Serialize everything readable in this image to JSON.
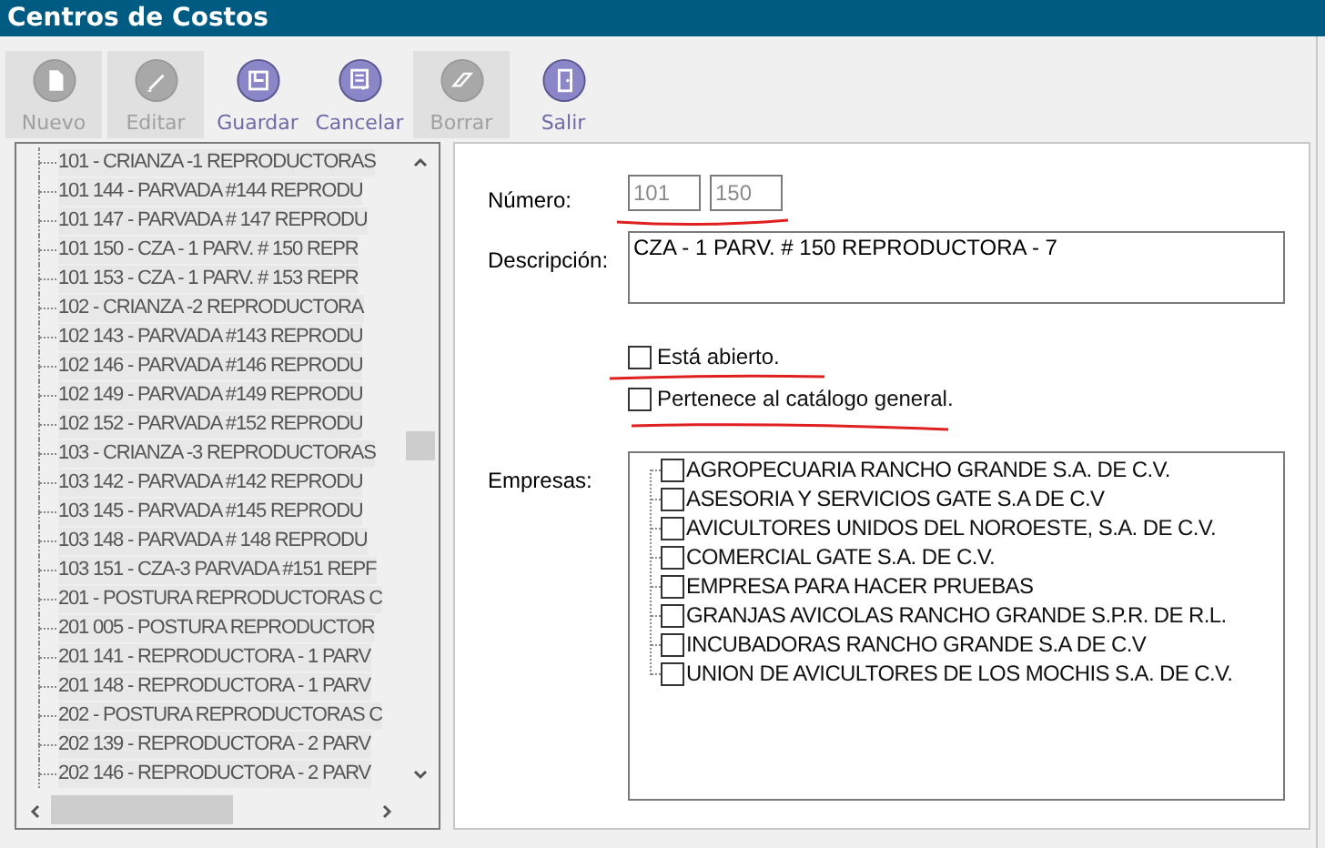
{
  "window": {
    "title": "Centros de Costos"
  },
  "toolbar": [
    {
      "label": "Nuevo",
      "kind": "new",
      "disabled": true
    },
    {
      "label": "Editar",
      "kind": "edit",
      "disabled": true
    },
    {
      "label": "Guardar",
      "kind": "save",
      "disabled": false
    },
    {
      "label": "Cancelar",
      "kind": "cancel",
      "disabled": false
    },
    {
      "label": "Borrar",
      "kind": "delete",
      "disabled": true
    },
    {
      "label": "Salir",
      "kind": "exit",
      "disabled": false
    }
  ],
  "tree": {
    "items": [
      "101 - CRIANZA -1  REPRODUCTORAS",
      "101 144 - PARVADA  #144  REPRODU",
      "101 147 - PARVADA # 147  REPRODU",
      "101 150 - CZA - 1  PARV. # 150  REPR",
      "101 153 - CZA - 1  PARV. # 153  REPR",
      "102 - CRIANZA  -2   REPRODUCTORA",
      "102 143 - PARVADA  #143 REPRODU",
      "102 146 - PARVADA  #146 REPRODU",
      "102 149 - PARVADA #149  REPRODU",
      "102 152 - PARVADA #152  REPRODU",
      "103 - CRIANZA -3  REPRODUCTORAS",
      "103 142 - PARVADA #142  REPRODU",
      "103 145 - PARVADA  #145 REPRODU",
      "103 148 - PARVADA # 148  REPRODU",
      "103 151 - CZA-3 PARVADA #151 REPF",
      "201 - POSTURA REPRODUCTORAS C",
      "201 005 - POSTURA REPRODUCTOR",
      "201 141 - REPRODUCTORA - 1  PARV",
      "201 148 - REPRODUCTORA - 1  PARV",
      "202 - POSTURA REPRODUCTORAS C",
      "202 139 - REPRODUCTORA - 2  PARV",
      "202 146 - REPRODUCTORA - 2  PARV"
    ]
  },
  "form": {
    "numero_label": "Número:",
    "numero": [
      "101",
      "150"
    ],
    "descripcion_label": "Descripción:",
    "descripcion": "CZA - 1  PARV. # 150  REPRODUCTORA - 7",
    "checks": [
      {
        "label": "Está abierto.",
        "checked": false
      },
      {
        "label": "Pertenece al catálogo general.",
        "checked": false
      }
    ],
    "empresas_label": "Empresas:",
    "empresas": [
      {
        "label": "AGROPECUARIA RANCHO GRANDE S.A. DE C.V.",
        "checked": false
      },
      {
        "label": "ASESORIA Y SERVICIOS GATE S.A DE C.V",
        "checked": false
      },
      {
        "label": "AVICULTORES UNIDOS DEL NOROESTE, S.A. DE C.V.",
        "checked": false
      },
      {
        "label": "COMERCIAL GATE S.A. DE C.V.",
        "checked": false
      },
      {
        "label": "EMPRESA PARA HACER PRUEBAS",
        "checked": false
      },
      {
        "label": "GRANJAS AVICOLAS RANCHO GRANDE S.P.R. DE R.L.",
        "checked": false
      },
      {
        "label": "INCUBADORAS RANCHO GRANDE S.A DE C.V",
        "checked": false
      },
      {
        "label": "UNION DE AVICULTORES DE LOS MOCHIS S.A. DE C.V.",
        "checked": false
      }
    ]
  }
}
